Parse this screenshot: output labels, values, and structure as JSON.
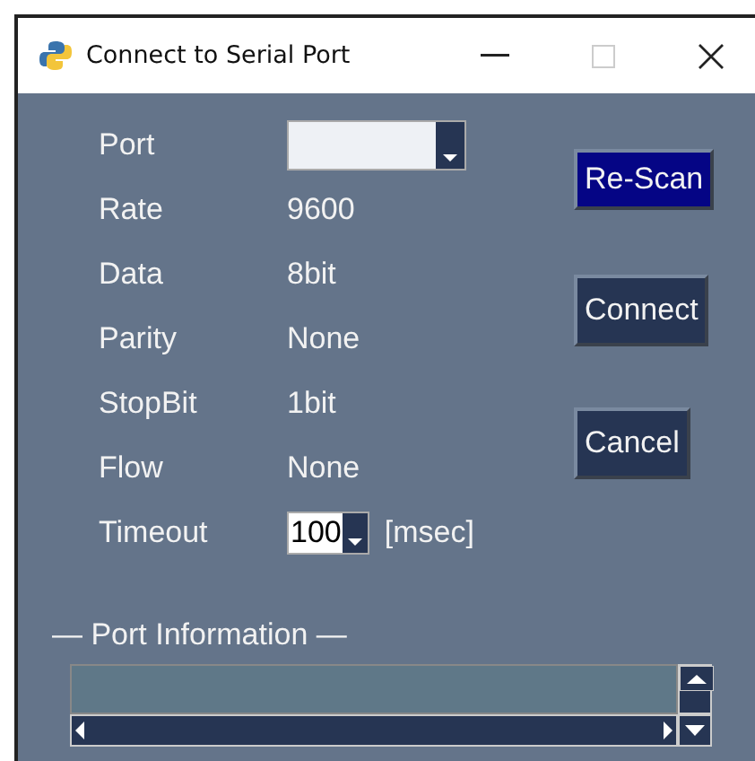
{
  "window": {
    "title": "Connect to Serial Port"
  },
  "fields": [
    {
      "label": "Port",
      "kind": "combo"
    },
    {
      "label": "Rate",
      "kind": "text",
      "value": "9600"
    },
    {
      "label": "Data",
      "kind": "text",
      "value": "8bit"
    },
    {
      "label": "Parity",
      "kind": "text",
      "value": "None"
    },
    {
      "label": "StopBit",
      "kind": "text",
      "value": "1bit"
    },
    {
      "label": "Flow",
      "kind": "text",
      "value": "None"
    },
    {
      "label": "Timeout",
      "kind": "spin",
      "value": "100",
      "unit": "[msec]"
    }
  ],
  "buttons": [
    {
      "label": "Re-Scan",
      "selected": true
    },
    {
      "label": "Connect",
      "selected": false
    },
    {
      "label": "Cancel",
      "selected": false
    }
  ],
  "port_information": {
    "title": "— Port Information —"
  }
}
